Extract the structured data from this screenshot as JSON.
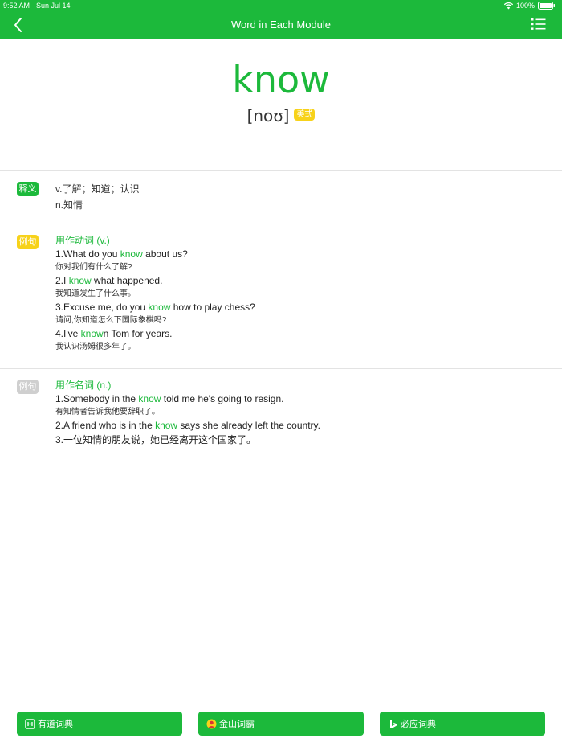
{
  "status_bar": {
    "time": "9:52 AM",
    "date": "Sun Jul 14",
    "battery": "100%"
  },
  "navbar": {
    "title": "Word in Each Module"
  },
  "word": {
    "headword": "know",
    "phonetic": "[noʊ]",
    "accent_label": "美式"
  },
  "definitions": {
    "tag": "释义",
    "lines": [
      "v.了解；知道；认识",
      "n.知情"
    ]
  },
  "verb_examples": {
    "tag": "例句",
    "heading": "用作动词 (v.)",
    "items": [
      {
        "en_pre": "1.What do you ",
        "en_hl": "know",
        "en_post": " about us?",
        "zh": "你对我们有什么了解?"
      },
      {
        "en_pre": "2.I ",
        "en_hl": "know",
        "en_post": " what happened.",
        "zh": "我知道发生了什么事。"
      },
      {
        "en_pre": "3.Excuse me, do you ",
        "en_hl": "know",
        "en_post": " how to play chess?",
        "zh": "请问,你知道怎么下国际象棋吗?"
      },
      {
        "en_pre": "4.I've ",
        "en_hl": "know",
        "en_post": "n Tom for years.",
        "zh": "我认识汤姆很多年了。"
      }
    ]
  },
  "noun_examples": {
    "tag": "例句",
    "heading": "用作名词 (n.)",
    "items": [
      {
        "en_pre": "1.Somebody in the ",
        "en_hl": "know",
        "en_post": " told me he's going to resign.",
        "zh": "有知情者告诉我他要辞职了。"
      },
      {
        "en_pre": "2.A friend who is in the ",
        "en_hl": "know",
        "en_post": " says she already left the country.",
        "zh": ""
      }
    ],
    "extra_line": "3.一位知情的朋友说，她已经离开这个国家了。"
  },
  "bottom_buttons": [
    {
      "label": "有道词典",
      "icon": "youdao-icon"
    },
    {
      "label": "金山词霸",
      "icon": "iciba-icon"
    },
    {
      "label": "必应词典",
      "icon": "bing-icon"
    }
  ],
  "colors": {
    "accent": "#1cb93b",
    "badge_yellow": "#f7d21a",
    "tag_gray": "#cfcfcf"
  }
}
